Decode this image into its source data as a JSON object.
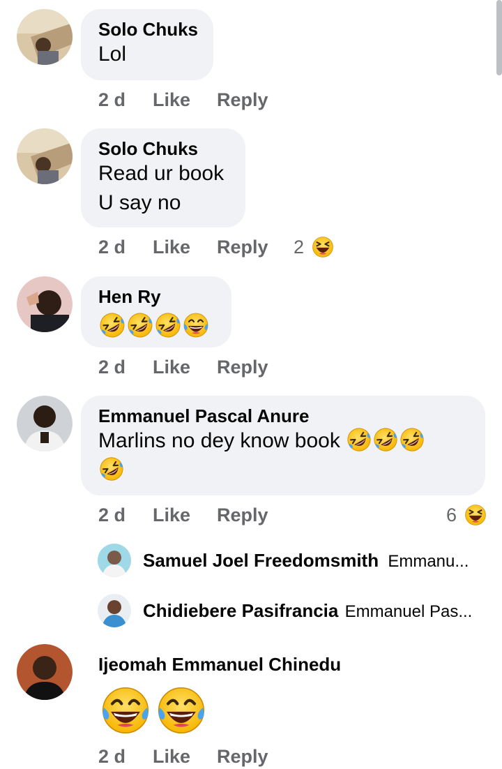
{
  "comments": [
    {
      "author": "Solo Chuks",
      "lines": [
        "Lol"
      ],
      "time": "2 d",
      "like": "Like",
      "reply": "Reply"
    },
    {
      "author": "Solo Chuks",
      "lines": [
        "Read ur book",
        "U say no"
      ],
      "time": "2 d",
      "like": "Like",
      "reply": "Reply",
      "reaction_count": "2"
    },
    {
      "author": "Hen Ry",
      "time": "2 d",
      "like": "Like",
      "reply": "Reply"
    },
    {
      "author": "Emmanuel Pascal Anure",
      "lines": [
        "Marlins no dey know book"
      ],
      "time": "2 d",
      "like": "Like",
      "reply": "Reply",
      "reaction_count": "6"
    },
    {
      "author": "Ijeomah Emmanuel Chinedu",
      "time": "2 d",
      "like": "Like",
      "reply": "Reply"
    }
  ],
  "replies": [
    {
      "author": "Samuel Joel Freedomsmith",
      "snippet": "Emmanu..."
    },
    {
      "author": "Chidiebere Pasifrancia",
      "snippet": "Emmanuel Pas..."
    }
  ],
  "colors": {
    "bubble": "#f0f2f5",
    "meta": "#65676b",
    "emoji_face": "#ffcc33",
    "tear": "#4aa3ef"
  }
}
